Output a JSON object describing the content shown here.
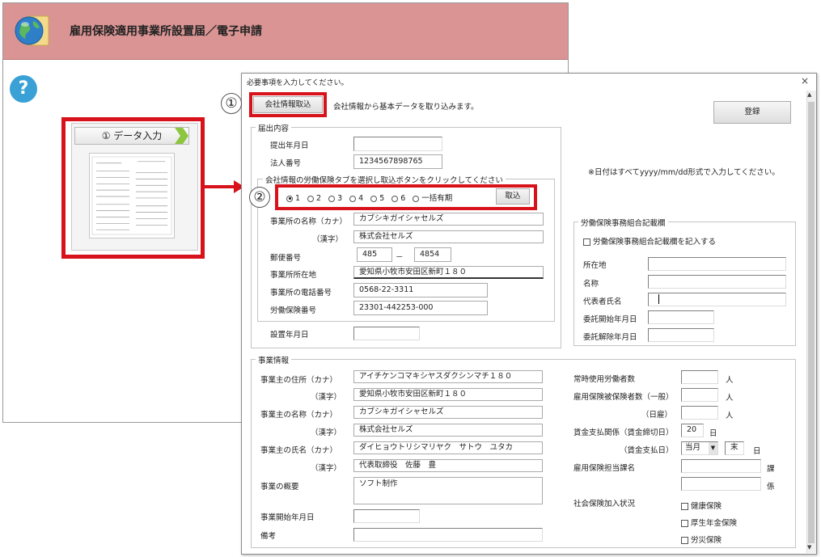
{
  "app": {
    "title": "雇用保険適用事業所設置届／電子申請",
    "help_label": "?",
    "tile_button_label": "① データ入力"
  },
  "dialog": {
    "title": "必要事項を入力してください。",
    "close": "×",
    "step1_marker": "①",
    "step2_marker": "②",
    "import_company_button": "会社情報取込",
    "import_company_desc": "会社情報から基本データを取り込みます。",
    "register_button": "登録",
    "date_note": "※日付はすべてyyyy/mm/dd形式で入力してください。"
  },
  "filing": {
    "group_label": "届出内容",
    "submit_date_label": "提出年月日",
    "submit_date_value": "",
    "corp_number_label": "法人番号",
    "corp_number_value": "1234567898765",
    "insurance_group_label": "会社情報の労働保険タブを選択し取込ボタンをクリックしてください",
    "radio_options": [
      "1",
      "2",
      "3",
      "4",
      "5",
      "6",
      "一括有期"
    ],
    "selected_radio": "1",
    "import_button": "取込",
    "office_name_kana_label": "事業所の名称（カナ）",
    "office_name_kana_value": "カブシキガイシャセルズ",
    "office_name_kanji_label": "（漢字）",
    "office_name_kanji_value": "株式会社セルズ",
    "postal_label": "郵便番号",
    "postal_1": "485",
    "postal_dash": "－",
    "postal_2": "4854",
    "address_label": "事業所所在地",
    "address_value": "愛知県小牧市安田区新町１８０",
    "phone_label": "事業所の電話番号",
    "phone_value": "0568-22-3311",
    "labor_number_label": "労働保険番号",
    "labor_number_value": "23301-442253-000",
    "established_label": "設置年月日",
    "established_value": ""
  },
  "union": {
    "group_label": "労働保険事務組合記載欄",
    "fill_checkbox_label": "労働保険事務組合記載欄を記入する",
    "address_label": "所在地",
    "name_label": "名称",
    "rep_label": "代表者氏名",
    "entrust_start_label": "委託開始年月日",
    "entrust_end_label": "委託解除年月日"
  },
  "business": {
    "group_label": "事業情報",
    "owner_addr_kana_label": "事業主の住所（カナ）",
    "owner_addr_kana_value": "アイチケンコマキシヤスダクシンマチ１８０",
    "owner_addr_kanji_label": "（漢字）",
    "owner_addr_kanji_value": "愛知県小牧市安田区新町１８０",
    "owner_name_kana_label": "事業主の名称（カナ）",
    "owner_name_kana_value": "カブシキガイシャセルズ",
    "owner_name_kanji_label": "（漢字）",
    "owner_name_kanji_value": "株式会社セルズ",
    "owner_person_kana_label": "事業主の氏名（カナ）",
    "owner_person_kana_value": "ダイヒョウトリシマリヤク　サトウ　ユタカ",
    "owner_person_kanji_label": "（漢字）",
    "owner_person_kanji_value": "代表取締役　佐藤　豊",
    "summary_label": "事業の概要",
    "summary_value": "ソフト制作",
    "start_date_label": "事業開始年月日",
    "remarks_label": "備考",
    "workers_label": "常時使用労働者数",
    "insured_general_label": "雇用保険被保険者数（一般）",
    "insured_daily_label": "（日雇）",
    "person_unit": "人",
    "wage_cutoff_label": "賃金支払関係（賃金締切日）",
    "wage_cutoff_value": "20",
    "day_unit": "日",
    "wage_pay_label": "（賃金支払日）",
    "wage_pay_month": "当月",
    "wage_pay_day": "末",
    "section_label": "雇用保険担当課名",
    "section_unit": "課",
    "subsection_unit": "係",
    "social_label": "社会保険加入状況",
    "health_label": "健康保険",
    "pension_label": "厚生年金保険",
    "accident_label": "労災保険"
  }
}
